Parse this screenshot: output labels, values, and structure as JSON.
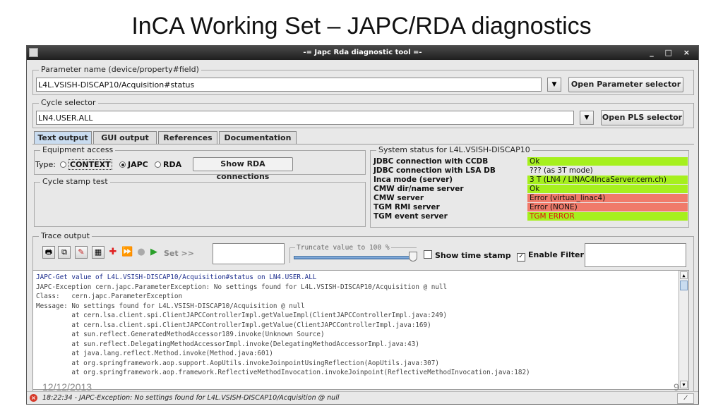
{
  "slide": {
    "title": "InCA Working Set – JAPC/RDA diagnostics",
    "date": "12/12/2013",
    "page": "9"
  },
  "window": {
    "title": "-= Japc Rda diagnostic tool =-",
    "controls": "_ □ ×"
  },
  "parameter": {
    "legend": "Parameter name (device/property#field)",
    "value": "L4L.VSISH-DISCAP10/Acquisition#status",
    "button": "Open Parameter selector"
  },
  "cycle": {
    "legend": "Cycle selector",
    "value": "LN4.USER.ALL",
    "button": "Open PLS selector"
  },
  "tabs": [
    "Text output",
    "GUI output",
    "References",
    "Documentation"
  ],
  "equipment": {
    "legend": "Equipment access",
    "type_label": "Type:",
    "options": [
      "CONTEXT",
      "JAPC",
      "RDA"
    ],
    "selected": "JAPC",
    "button": "Show RDA connections"
  },
  "cycle_stamp": {
    "legend": "Cycle stamp test"
  },
  "system_status": {
    "legend": "System status  for L4L.VSISH-DISCAP10",
    "rows": [
      {
        "label": "JDBC connection with CCDB",
        "value": "Ok",
        "color": "#a6f01e",
        "text_color": "#111"
      },
      {
        "label": "JDBC connection with LSA DB",
        "value": "??? (as 3T mode)",
        "color": "#e8e8e8",
        "text_color": "#111"
      },
      {
        "label": "Inca mode (server)",
        "value": "3 T (LN4 / LINAC4IncaServer.cern.ch)",
        "color": "#a6f01e",
        "text_color": "#111"
      },
      {
        "label": "CMW dir/name server",
        "value": "Ok",
        "color": "#a6f01e",
        "text_color": "#111"
      },
      {
        "label": "CMW server",
        "value": "Error  (virtual_linac4)",
        "color": "#f07a6a",
        "text_color": "#111"
      },
      {
        "label": "TGM RMI server",
        "value": "Error  (NONE)",
        "color": "#f07a6a",
        "text_color": "#111"
      },
      {
        "label": "TGM event server",
        "value": "TGM ERROR",
        "color": "#a6f01e",
        "text_color": "#e01010"
      }
    ]
  },
  "trace": {
    "legend": "Trace output",
    "set_label": "Set >>",
    "truncate_label": "Truncate value to 100 %",
    "truncate_percent": 100,
    "show_time_stamp": "Show time stamp",
    "show_time_stamp_checked": false,
    "enable_filter": "Enable Filter",
    "enable_filter_checked": true
  },
  "log_lines": [
    "JAPC-Get value of L4L.VSISH-DISCAP10/Acquisition#status on LN4.USER.ALL",
    "JAPC-Exception cern.japc.ParameterException: No settings found for L4L.VSISH-DISCAP10/Acquisition @ null",
    "Class:   cern.japc.ParameterException",
    "Message: No settings found for L4L.VSISH-DISCAP10/Acquisition @ null",
    "         at cern.lsa.client.spi.ClientJAPCControllerImpl.getValueImpl(ClientJAPCControllerImpl.java:249)",
    "         at cern.lsa.client.spi.ClientJAPCControllerImpl.getValue(ClientJAPCControllerImpl.java:169)",
    "         at sun.reflect.GeneratedMethodAccessor189.invoke(Unknown Source)",
    "         at sun.reflect.DelegatingMethodAccessorImpl.invoke(DelegatingMethodAccessorImpl.java:43)",
    "         at java.lang.reflect.Method.invoke(Method.java:601)",
    "         at org.springframework.aop.support.AopUtils.invokeJoinpointUsingReflection(AopUtils.java:307)",
    "         at org.springframework.aop.framework.ReflectiveMethodInvocation.invokeJoinpoint(ReflectiveMethodInvocation.java:182)"
  ],
  "statusbar": {
    "message": "18:22:34 - JAPC-Exception: No settings found for L4L.VSISH-DISCAP10/Acquisition @ null"
  }
}
